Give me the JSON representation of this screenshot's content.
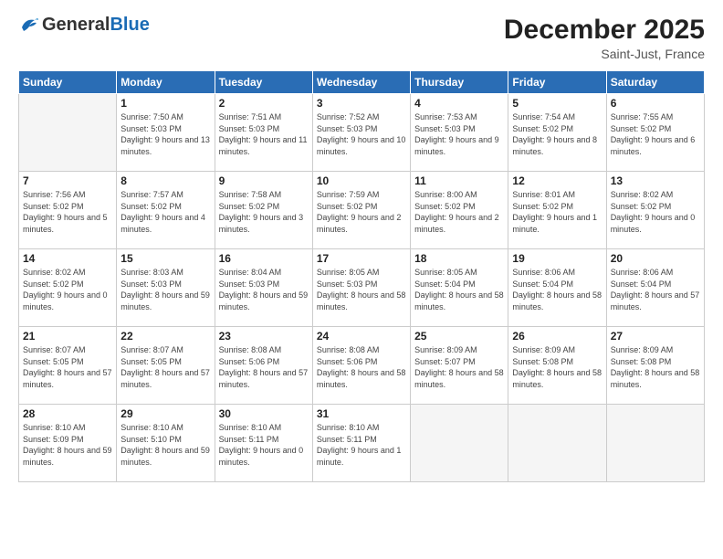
{
  "header": {
    "logo_general": "General",
    "logo_blue": "Blue",
    "month_year": "December 2025",
    "location": "Saint-Just, France"
  },
  "weekdays": [
    "Sunday",
    "Monday",
    "Tuesday",
    "Wednesday",
    "Thursday",
    "Friday",
    "Saturday"
  ],
  "weeks": [
    [
      {
        "day": "",
        "sunrise": "",
        "sunset": "",
        "daylight": ""
      },
      {
        "day": "1",
        "sunrise": "Sunrise: 7:50 AM",
        "sunset": "Sunset: 5:03 PM",
        "daylight": "Daylight: 9 hours and 13 minutes."
      },
      {
        "day": "2",
        "sunrise": "Sunrise: 7:51 AM",
        "sunset": "Sunset: 5:03 PM",
        "daylight": "Daylight: 9 hours and 11 minutes."
      },
      {
        "day": "3",
        "sunrise": "Sunrise: 7:52 AM",
        "sunset": "Sunset: 5:03 PM",
        "daylight": "Daylight: 9 hours and 10 minutes."
      },
      {
        "day": "4",
        "sunrise": "Sunrise: 7:53 AM",
        "sunset": "Sunset: 5:03 PM",
        "daylight": "Daylight: 9 hours and 9 minutes."
      },
      {
        "day": "5",
        "sunrise": "Sunrise: 7:54 AM",
        "sunset": "Sunset: 5:02 PM",
        "daylight": "Daylight: 9 hours and 8 minutes."
      },
      {
        "day": "6",
        "sunrise": "Sunrise: 7:55 AM",
        "sunset": "Sunset: 5:02 PM",
        "daylight": "Daylight: 9 hours and 6 minutes."
      }
    ],
    [
      {
        "day": "7",
        "sunrise": "Sunrise: 7:56 AM",
        "sunset": "Sunset: 5:02 PM",
        "daylight": "Daylight: 9 hours and 5 minutes."
      },
      {
        "day": "8",
        "sunrise": "Sunrise: 7:57 AM",
        "sunset": "Sunset: 5:02 PM",
        "daylight": "Daylight: 9 hours and 4 minutes."
      },
      {
        "day": "9",
        "sunrise": "Sunrise: 7:58 AM",
        "sunset": "Sunset: 5:02 PM",
        "daylight": "Daylight: 9 hours and 3 minutes."
      },
      {
        "day": "10",
        "sunrise": "Sunrise: 7:59 AM",
        "sunset": "Sunset: 5:02 PM",
        "daylight": "Daylight: 9 hours and 2 minutes."
      },
      {
        "day": "11",
        "sunrise": "Sunrise: 8:00 AM",
        "sunset": "Sunset: 5:02 PM",
        "daylight": "Daylight: 9 hours and 2 minutes."
      },
      {
        "day": "12",
        "sunrise": "Sunrise: 8:01 AM",
        "sunset": "Sunset: 5:02 PM",
        "daylight": "Daylight: 9 hours and 1 minute."
      },
      {
        "day": "13",
        "sunrise": "Sunrise: 8:02 AM",
        "sunset": "Sunset: 5:02 PM",
        "daylight": "Daylight: 9 hours and 0 minutes."
      }
    ],
    [
      {
        "day": "14",
        "sunrise": "Sunrise: 8:02 AM",
        "sunset": "Sunset: 5:02 PM",
        "daylight": "Daylight: 9 hours and 0 minutes."
      },
      {
        "day": "15",
        "sunrise": "Sunrise: 8:03 AM",
        "sunset": "Sunset: 5:03 PM",
        "daylight": "Daylight: 8 hours and 59 minutes."
      },
      {
        "day": "16",
        "sunrise": "Sunrise: 8:04 AM",
        "sunset": "Sunset: 5:03 PM",
        "daylight": "Daylight: 8 hours and 59 minutes."
      },
      {
        "day": "17",
        "sunrise": "Sunrise: 8:05 AM",
        "sunset": "Sunset: 5:03 PM",
        "daylight": "Daylight: 8 hours and 58 minutes."
      },
      {
        "day": "18",
        "sunrise": "Sunrise: 8:05 AM",
        "sunset": "Sunset: 5:04 PM",
        "daylight": "Daylight: 8 hours and 58 minutes."
      },
      {
        "day": "19",
        "sunrise": "Sunrise: 8:06 AM",
        "sunset": "Sunset: 5:04 PM",
        "daylight": "Daylight: 8 hours and 58 minutes."
      },
      {
        "day": "20",
        "sunrise": "Sunrise: 8:06 AM",
        "sunset": "Sunset: 5:04 PM",
        "daylight": "Daylight: 8 hours and 57 minutes."
      }
    ],
    [
      {
        "day": "21",
        "sunrise": "Sunrise: 8:07 AM",
        "sunset": "Sunset: 5:05 PM",
        "daylight": "Daylight: 8 hours and 57 minutes."
      },
      {
        "day": "22",
        "sunrise": "Sunrise: 8:07 AM",
        "sunset": "Sunset: 5:05 PM",
        "daylight": "Daylight: 8 hours and 57 minutes."
      },
      {
        "day": "23",
        "sunrise": "Sunrise: 8:08 AM",
        "sunset": "Sunset: 5:06 PM",
        "daylight": "Daylight: 8 hours and 57 minutes."
      },
      {
        "day": "24",
        "sunrise": "Sunrise: 8:08 AM",
        "sunset": "Sunset: 5:06 PM",
        "daylight": "Daylight: 8 hours and 58 minutes."
      },
      {
        "day": "25",
        "sunrise": "Sunrise: 8:09 AM",
        "sunset": "Sunset: 5:07 PM",
        "daylight": "Daylight: 8 hours and 58 minutes."
      },
      {
        "day": "26",
        "sunrise": "Sunrise: 8:09 AM",
        "sunset": "Sunset: 5:08 PM",
        "daylight": "Daylight: 8 hours and 58 minutes."
      },
      {
        "day": "27",
        "sunrise": "Sunrise: 8:09 AM",
        "sunset": "Sunset: 5:08 PM",
        "daylight": "Daylight: 8 hours and 58 minutes."
      }
    ],
    [
      {
        "day": "28",
        "sunrise": "Sunrise: 8:10 AM",
        "sunset": "Sunset: 5:09 PM",
        "daylight": "Daylight: 8 hours and 59 minutes."
      },
      {
        "day": "29",
        "sunrise": "Sunrise: 8:10 AM",
        "sunset": "Sunset: 5:10 PM",
        "daylight": "Daylight: 8 hours and 59 minutes."
      },
      {
        "day": "30",
        "sunrise": "Sunrise: 8:10 AM",
        "sunset": "Sunset: 5:11 PM",
        "daylight": "Daylight: 9 hours and 0 minutes."
      },
      {
        "day": "31",
        "sunrise": "Sunrise: 8:10 AM",
        "sunset": "Sunset: 5:11 PM",
        "daylight": "Daylight: 9 hours and 1 minute."
      },
      {
        "day": "",
        "sunrise": "",
        "sunset": "",
        "daylight": ""
      },
      {
        "day": "",
        "sunrise": "",
        "sunset": "",
        "daylight": ""
      },
      {
        "day": "",
        "sunrise": "",
        "sunset": "",
        "daylight": ""
      }
    ]
  ]
}
